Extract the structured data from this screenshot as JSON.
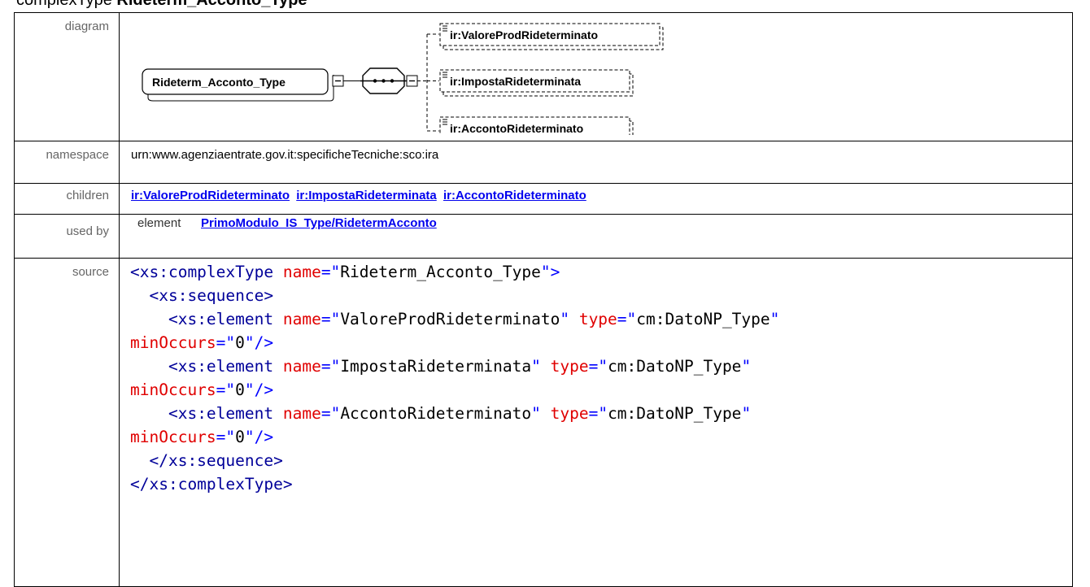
{
  "header": {
    "prefix": "complexType",
    "name": "Rideterm_Acconto_Type"
  },
  "rows": {
    "diagram": {
      "label": "diagram",
      "root": "Rideterm_Acconto_Type",
      "elements": [
        "ir:ValoreProdRideterminato",
        "ir:ImpostaRideterminata",
        "ir:AccontoRideterminato"
      ]
    },
    "namespace": {
      "label": "namespace",
      "value": "urn:www.agenziaentrate.gov.it:specificheTecniche:sco:ira"
    },
    "children": {
      "label": "children",
      "links": [
        "ir:ValoreProdRideterminato",
        "ir:ImpostaRideterminata",
        "ir:AccontoRideterminato"
      ]
    },
    "used_by": {
      "label": "used by",
      "kind": "element",
      "link": "PrimoModulo_IS_Type/RidetermAcconto"
    },
    "source": {
      "label": "source",
      "lines": [
        [
          [
            "t",
            "<xs:complexType "
          ],
          [
            "a",
            "name"
          ],
          [
            "p",
            "=\""
          ],
          [
            "v",
            "Rideterm_Acconto_Type"
          ],
          [
            "p",
            "\">"
          ]
        ],
        [
          [
            "s",
            "  "
          ],
          [
            "t",
            "<xs:sequence>"
          ]
        ],
        [
          [
            "s",
            "    "
          ],
          [
            "t",
            "<xs:element "
          ],
          [
            "a",
            "name"
          ],
          [
            "p",
            "=\""
          ],
          [
            "v",
            "ValoreProdRideterminato"
          ],
          [
            "p",
            "\" "
          ],
          [
            "a",
            "type"
          ],
          [
            "p",
            "=\""
          ],
          [
            "v",
            "cm:DatoNP_Type"
          ],
          [
            "p",
            "\""
          ]
        ],
        [
          [
            "a",
            "minOccurs"
          ],
          [
            "p",
            "=\""
          ],
          [
            "v",
            "0"
          ],
          [
            "p",
            "\"/>"
          ]
        ],
        [
          [
            "s",
            "    "
          ],
          [
            "t",
            "<xs:element "
          ],
          [
            "a",
            "name"
          ],
          [
            "p",
            "=\""
          ],
          [
            "v",
            "ImpostaRideterminata"
          ],
          [
            "p",
            "\" "
          ],
          [
            "a",
            "type"
          ],
          [
            "p",
            "=\""
          ],
          [
            "v",
            "cm:DatoNP_Type"
          ],
          [
            "p",
            "\""
          ]
        ],
        [
          [
            "a",
            "minOccurs"
          ],
          [
            "p",
            "=\""
          ],
          [
            "v",
            "0"
          ],
          [
            "p",
            "\"/>"
          ]
        ],
        [
          [
            "s",
            "    "
          ],
          [
            "t",
            "<xs:element "
          ],
          [
            "a",
            "name"
          ],
          [
            "p",
            "=\""
          ],
          [
            "v",
            "AccontoRideterminato"
          ],
          [
            "p",
            "\" "
          ],
          [
            "a",
            "type"
          ],
          [
            "p",
            "=\""
          ],
          [
            "v",
            "cm:DatoNP_Type"
          ],
          [
            "p",
            "\""
          ]
        ],
        [
          [
            "a",
            "minOccurs"
          ],
          [
            "p",
            "=\""
          ],
          [
            "v",
            "0"
          ],
          [
            "p",
            "\"/>"
          ]
        ],
        [
          [
            "s",
            "  "
          ],
          [
            "t",
            "</xs:sequence>"
          ]
        ],
        [
          [
            "t",
            "</xs:complexType>"
          ]
        ]
      ]
    }
  }
}
